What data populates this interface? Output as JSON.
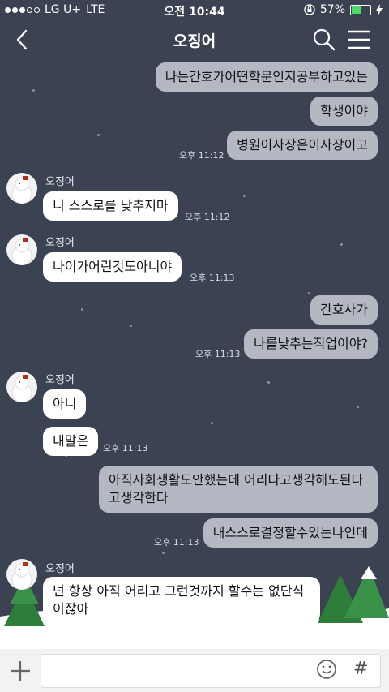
{
  "status_bar": {
    "carrier": "LG U+",
    "network": "LTE",
    "time": "오전 10:44",
    "battery": "57%",
    "battery_level": 0.57
  },
  "header": {
    "title": "오징어"
  },
  "messages": [
    {
      "side": "me",
      "text": "나는간호가어떤학문인지공부하고있는"
    },
    {
      "side": "me",
      "text": "학생이야"
    },
    {
      "side": "me",
      "text": "병원이사장은이사장이고",
      "time": "오후 11:12"
    },
    {
      "side": "them",
      "sender": "오징어",
      "text": "니 스스로를 낮추지마",
      "time": "오후 11:12"
    },
    {
      "side": "them",
      "sender": "오징어",
      "text": "나이가어린것도아니야",
      "time": "오후 11:13"
    },
    {
      "side": "me",
      "text": "간호사가"
    },
    {
      "side": "me",
      "text": "나를낮추는직업이야?",
      "time": "오후 11:13"
    },
    {
      "side": "them",
      "sender": "오징어",
      "text": "아니"
    },
    {
      "side": "them",
      "text": "내말은",
      "time": "오후 11:13"
    },
    {
      "side": "me",
      "text": "아직사회생활도안했는데 어리다고생각해도된다고생각한다"
    },
    {
      "side": "me",
      "text": "내스스로결정할수있는나인데",
      "time": "오후 11:13"
    },
    {
      "side": "them",
      "sender": "오징어",
      "text": "넌 항상 아직 어리고 그런것까지  할수는 없단식이잖아"
    }
  ],
  "input_bar": {
    "hash_symbol": "#"
  }
}
